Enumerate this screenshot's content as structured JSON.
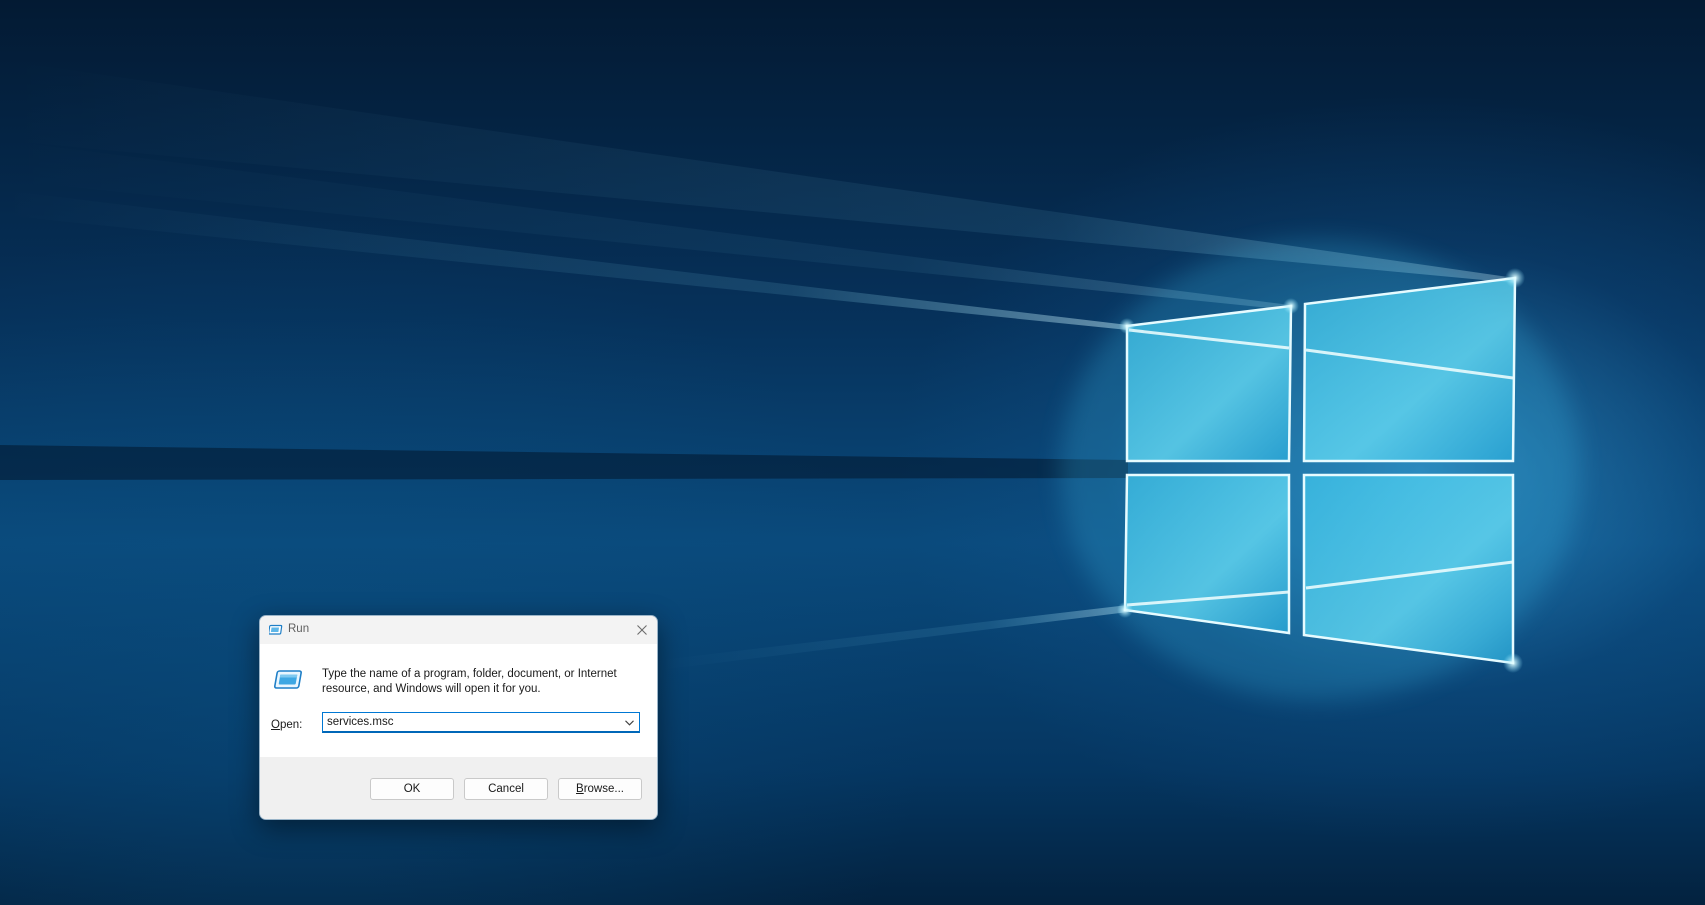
{
  "dialog": {
    "title": "Run",
    "description": "Type the name of a program, folder, document, or Internet resource, and Windows will open it for you.",
    "open_label_mnemonic": "O",
    "open_label_rest": "pen:",
    "open_value": "services.msc",
    "buttons": {
      "ok": "OK",
      "cancel": "Cancel",
      "browse_mnemonic": "B",
      "browse_rest": "rowse..."
    }
  },
  "icons": {
    "title_icon": "run-icon",
    "main_icon": "run-icon",
    "close": "close-icon",
    "dropdown": "chevron-down-icon"
  },
  "colors": {
    "accent": "#0078d4",
    "dialog_bg": "#f0f0f0",
    "content_bg": "#ffffff",
    "wallpaper_light": "#7fdcf2",
    "wallpaper_dark": "#031a33"
  }
}
